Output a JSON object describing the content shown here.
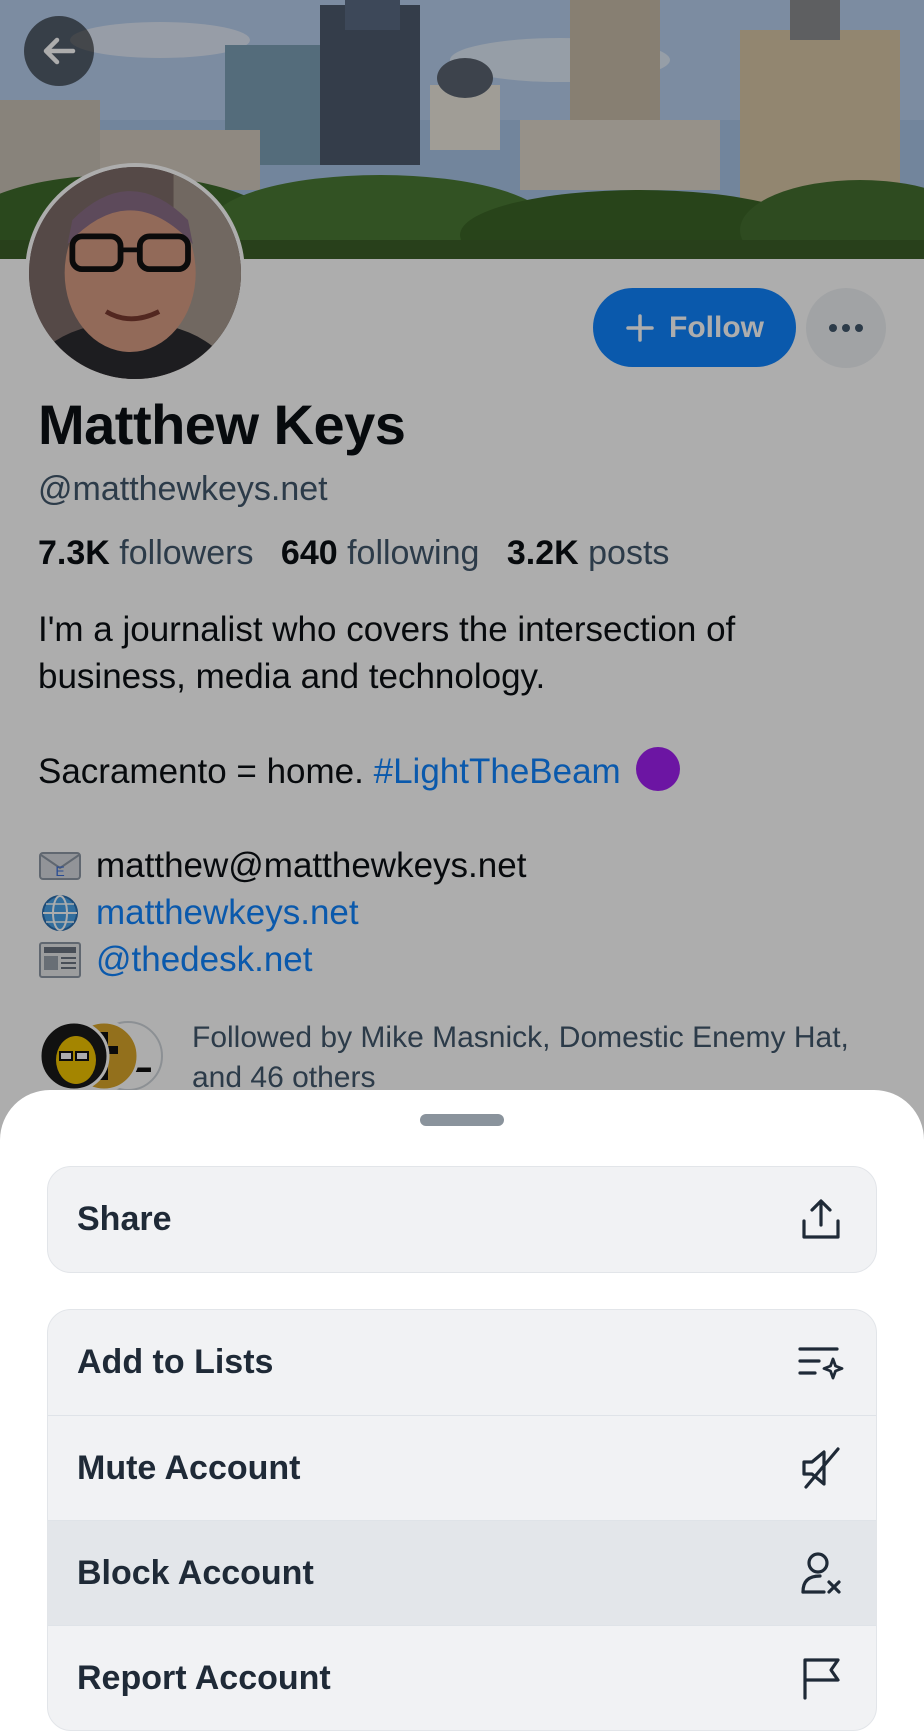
{
  "profile": {
    "name": "Matthew Keys",
    "handle": "@matthewkeys.net",
    "stats": {
      "followers_count": "7.3K",
      "followers_label": "followers",
      "following_count": "640",
      "following_label": "following",
      "posts_count": "3.2K",
      "posts_label": "posts"
    },
    "bio": {
      "line1": "I'm a journalist who covers the intersection of business, media and technology.",
      "line2_text": "Sacramento = home.",
      "line2_hashtag": "#LightTheBeam",
      "email": "matthew@matthewkeys.net",
      "website": "matthewkeys.net",
      "desk_handle": "@thedesk.net"
    },
    "followed_by": "Followed by Mike Masnick, Domestic Enemy Hat, and 46 others",
    "follow_button_label": "Follow"
  },
  "sheet": {
    "group1": [
      {
        "label": "Share",
        "icon": "share-icon"
      }
    ],
    "group2": [
      {
        "label": "Add to Lists",
        "icon": "add-to-list-icon"
      },
      {
        "label": "Mute Account",
        "icon": "mute-icon"
      },
      {
        "label": "Block Account",
        "icon": "block-user-icon"
      },
      {
        "label": "Report Account",
        "icon": "flag-icon"
      }
    ]
  },
  "colors": {
    "accent": "#1083fe",
    "muted_text": "#42576c",
    "hashtag_emoji_purple": "#a020f0"
  }
}
